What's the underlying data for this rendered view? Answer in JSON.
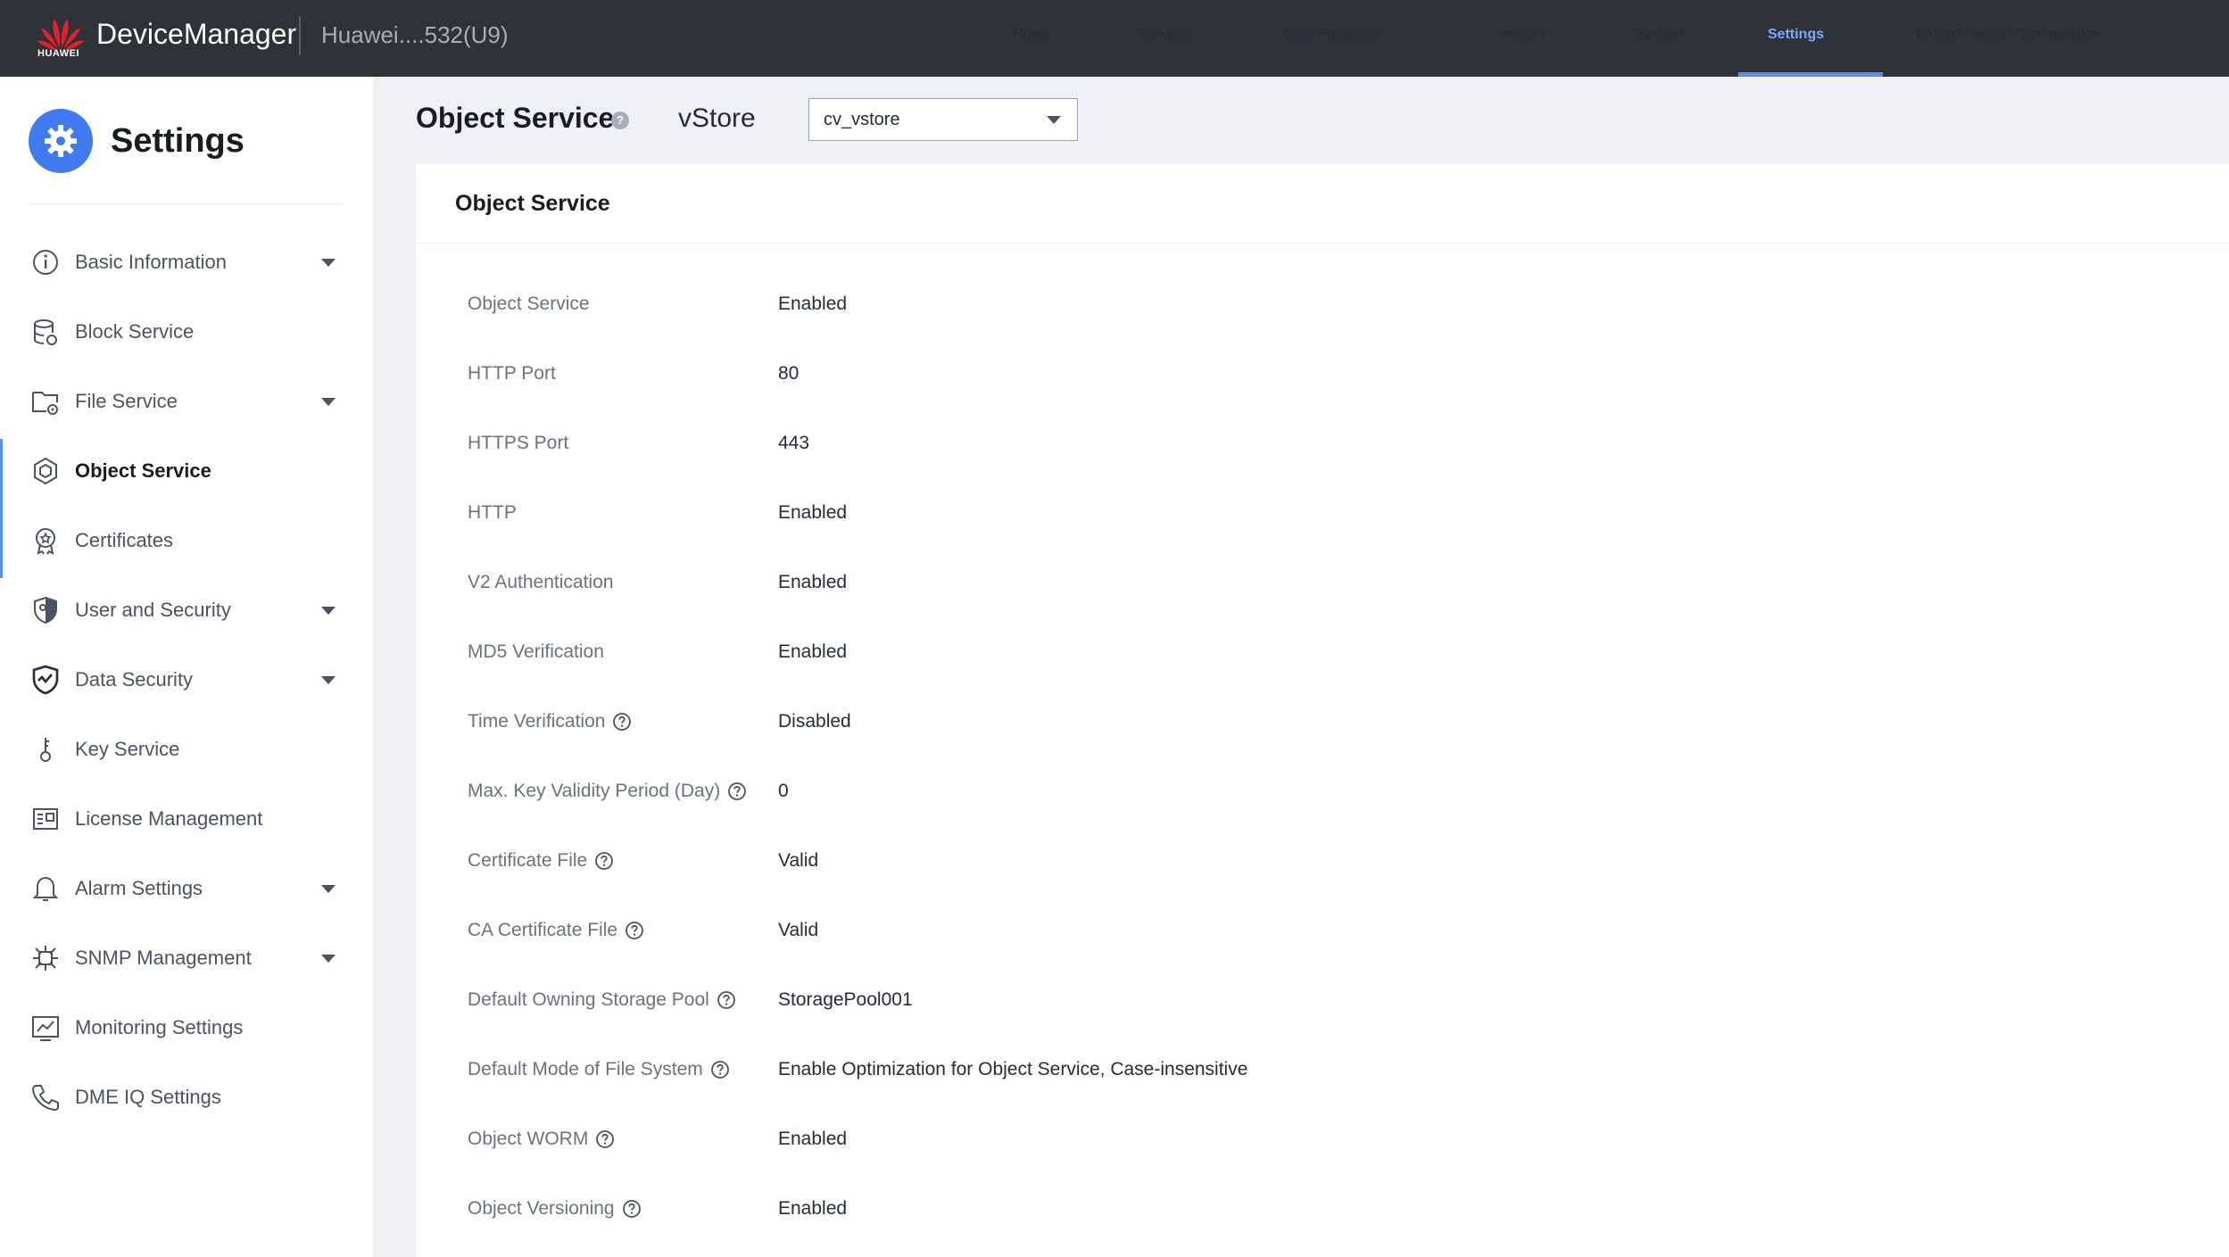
{
  "header": {
    "logo_text": "HUAWEI",
    "brand": "DeviceManager",
    "device": "Huawei....532(U9)",
    "nav": [
      {
        "label": "Home",
        "active": false
      },
      {
        "label": "Services",
        "active": false
      },
      {
        "label": "Data Protection",
        "active": false
      },
      {
        "label": "Insight",
        "active": false
      },
      {
        "label": "System",
        "active": false
      },
      {
        "label": "Settings",
        "active": true
      },
      {
        "label": "Wizard-Guided Configuration",
        "active": false
      }
    ]
  },
  "sidebar": {
    "title": "Settings",
    "items": [
      {
        "label": "Basic Information",
        "icon": "info-icon",
        "expandable": true
      },
      {
        "label": "Block Service",
        "icon": "database-icon",
        "expandable": false
      },
      {
        "label": "File Service",
        "icon": "folder-gear-icon",
        "expandable": true
      },
      {
        "label": "Object Service",
        "icon": "cube-icon",
        "expandable": false,
        "active": true
      },
      {
        "label": "Certificates",
        "icon": "certificate-icon",
        "expandable": false
      },
      {
        "label": "User and Security",
        "icon": "shield-user-icon",
        "expandable": true
      },
      {
        "label": "Data Security",
        "icon": "shield-check-icon",
        "expandable": true
      },
      {
        "label": "Key Service",
        "icon": "key-icon",
        "expandable": false
      },
      {
        "label": "License Management",
        "icon": "license-icon",
        "expandable": false
      },
      {
        "label": "Alarm Settings",
        "icon": "bell-icon",
        "expandable": true
      },
      {
        "label": "SNMP Management",
        "icon": "network-icon",
        "expandable": true
      },
      {
        "label": "Monitoring Settings",
        "icon": "chart-icon",
        "expandable": false
      },
      {
        "label": "DME IQ Settings",
        "icon": "phone-icon",
        "expandable": false
      }
    ]
  },
  "main": {
    "title": "Object Service",
    "help_glyph": "?",
    "vstore_label": "vStore",
    "vstore_value": "cv_vstore",
    "card_title": "Object Service",
    "fields": [
      {
        "label": "Object Service",
        "value": "Enabled",
        "help": false
      },
      {
        "label": "HTTP Port",
        "value": "80",
        "help": false
      },
      {
        "label": "HTTPS Port",
        "value": "443",
        "help": false
      },
      {
        "label": "HTTP",
        "value": "Enabled",
        "help": false
      },
      {
        "label": "V2 Authentication",
        "value": "Enabled",
        "help": false
      },
      {
        "label": "MD5 Verification",
        "value": "Enabled",
        "help": false
      },
      {
        "label": "Time Verification",
        "value": "Disabled",
        "help": true
      },
      {
        "label": "Max. Key Validity Period (Day)",
        "value": "0",
        "help": true
      },
      {
        "label": "Certificate File",
        "value": "Valid",
        "help": true
      },
      {
        "label": "CA Certificate File",
        "value": "Valid",
        "help": true
      },
      {
        "label": "Default Owning Storage Pool",
        "value": "StoragePool001",
        "help": true
      },
      {
        "label": "Default Mode of File System",
        "value": "Enable Optimization for Object Service, Case-insensitive",
        "help": true
      },
      {
        "label": "Object WORM",
        "value": "Enabled",
        "help": true
      },
      {
        "label": "Object Versioning",
        "value": "Enabled",
        "help": true
      }
    ]
  },
  "colors": {
    "topbar": "#2f3238",
    "accent": "#3f7af0",
    "active_nav": "#7fa7f5"
  }
}
